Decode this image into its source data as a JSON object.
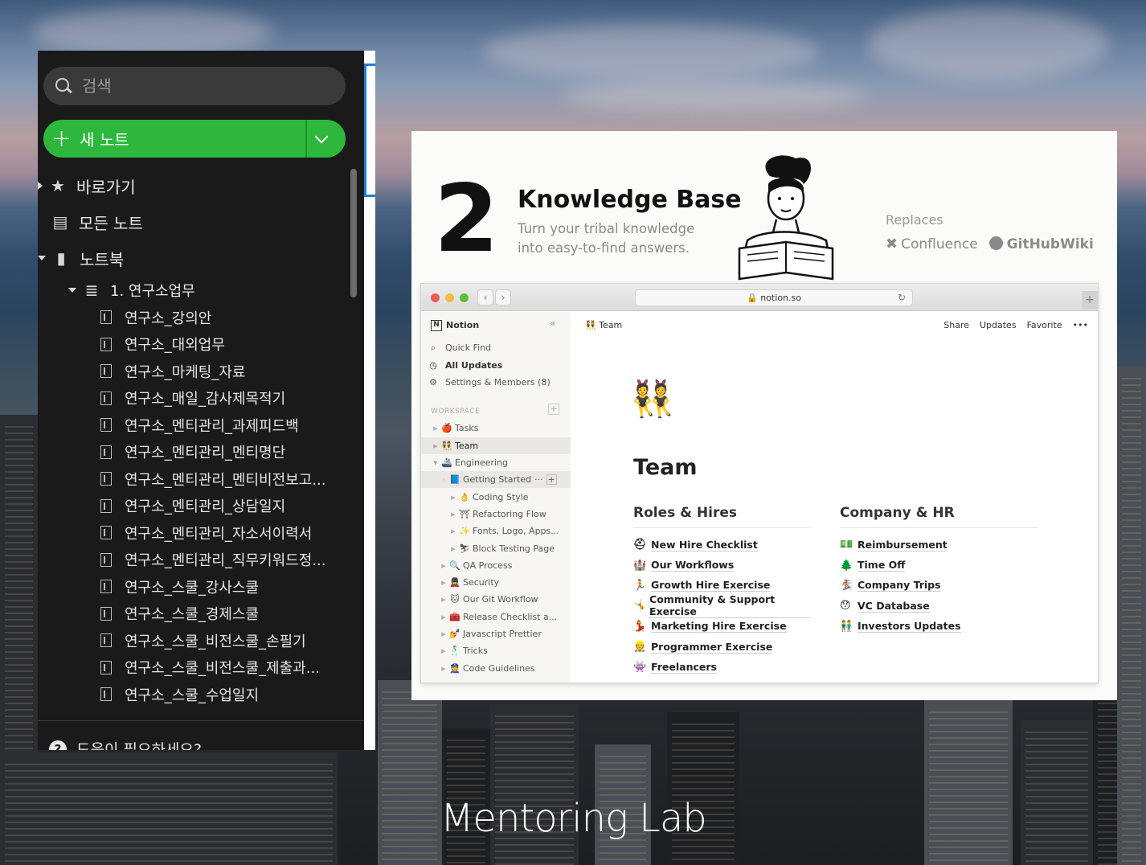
{
  "evernote": {
    "search": {
      "placeholder": "검색"
    },
    "new_note": {
      "label": "새 노트"
    },
    "nav": {
      "shortcuts": "바로가기",
      "all_notes": "모든 노트",
      "notebooks": "노트북",
      "notebook_name": "1. 연구소업무"
    },
    "notes": [
      "연구소_강의안",
      "연구소_대외업무",
      "연구소_마케팅_자료",
      "연구소_매일_감사제목적기",
      "연구소_멘티관리_과제피드백",
      "연구소_멘티관리_멘티명단",
      "연구소_멘티관리_멘티비전보고...",
      "연구소_멘티관리_상담일지",
      "연구소_멘티관리_자소서이력서",
      "연구소_멘티관리_직무키워드정...",
      "연구소_스쿨_강사스쿨",
      "연구소_스쿨_경제스쿨",
      "연구소_스쿨_비전스쿨_손필기",
      "연구소_스쿨_비전스쿨_제출과...",
      "연구소_스쿨_수업일지"
    ],
    "help": "도움이 필요하세요?"
  },
  "slide": {
    "number": "2",
    "title": "Knowledge Base",
    "subtitle_line1": "Turn your tribal knowledge",
    "subtitle_line2": "into easy-to-find answers.",
    "replaces_label": "Replaces",
    "replaces": [
      "Confluence",
      "GitHubWiki"
    ],
    "browser": {
      "url": "notion.so",
      "sidebar": {
        "workspace_name": "Notion",
        "quick_find": "Quick Find",
        "all_updates": "All Updates",
        "settings": "Settings & Members (8)",
        "workspace_label": "WORKSPACE",
        "pages": [
          {
            "emoji": "🍎",
            "label": "Tasks"
          },
          {
            "emoji": "👯",
            "label": "Team"
          },
          {
            "emoji": "🚢",
            "label": "Engineering"
          },
          {
            "emoji": "📘",
            "label": "Getting Started"
          },
          {
            "emoji": "👌",
            "label": "Coding Style"
          },
          {
            "emoji": "⛩",
            "label": "Refactoring Flow"
          },
          {
            "emoji": "✨",
            "label": "Fonts, Logo, Apps..."
          },
          {
            "emoji": "⛷",
            "label": "Block Testing Page"
          },
          {
            "emoji": "🔍",
            "label": "QA Process"
          },
          {
            "emoji": "💂",
            "label": "Security"
          },
          {
            "emoji": "🐱",
            "label": "Our Git Workflow"
          },
          {
            "emoji": "🧰",
            "label": "Release Checklist a..."
          },
          {
            "emoji": "💅",
            "label": "Javascript Prettier"
          },
          {
            "emoji": "🕺",
            "label": "Tricks"
          },
          {
            "emoji": "👮",
            "label": "Code Guidelines"
          }
        ]
      },
      "page": {
        "breadcrumb": "Team",
        "actions": [
          "Share",
          "Updates",
          "Favorite",
          "•••"
        ],
        "emoji": "👯",
        "title": "Team",
        "roles": {
          "heading": "Roles & Hires",
          "items": [
            {
              "emoji": "⛑",
              "label": "New Hire Checklist"
            },
            {
              "emoji": "🏰",
              "label": "Our Workflows"
            },
            {
              "emoji": "🏃",
              "label": "Growth Hire Exercise"
            },
            {
              "emoji": "🤸",
              "label": "Community & Support Exercise"
            },
            {
              "emoji": "💃",
              "label": "Marketing Hire Exercise"
            },
            {
              "emoji": "👷",
              "label": "Programmer Exercise"
            },
            {
              "emoji": "👾",
              "label": "Freelancers"
            }
          ]
        },
        "company": {
          "heading": "Company & HR",
          "items": [
            {
              "emoji": "💵",
              "label": "Reimbursement"
            },
            {
              "emoji": "🌲",
              "label": "Time Off"
            },
            {
              "emoji": "🏂",
              "label": "Company Trips"
            },
            {
              "emoji": "😯",
              "label": "VC Database"
            },
            {
              "emoji": "👬",
              "label": "Investors Updates"
            }
          ]
        }
      }
    }
  },
  "brand": "Mentoring Lab",
  "colors": {
    "evernote_green": "#2db83d",
    "evernote_bg": "#1a1a1a"
  }
}
